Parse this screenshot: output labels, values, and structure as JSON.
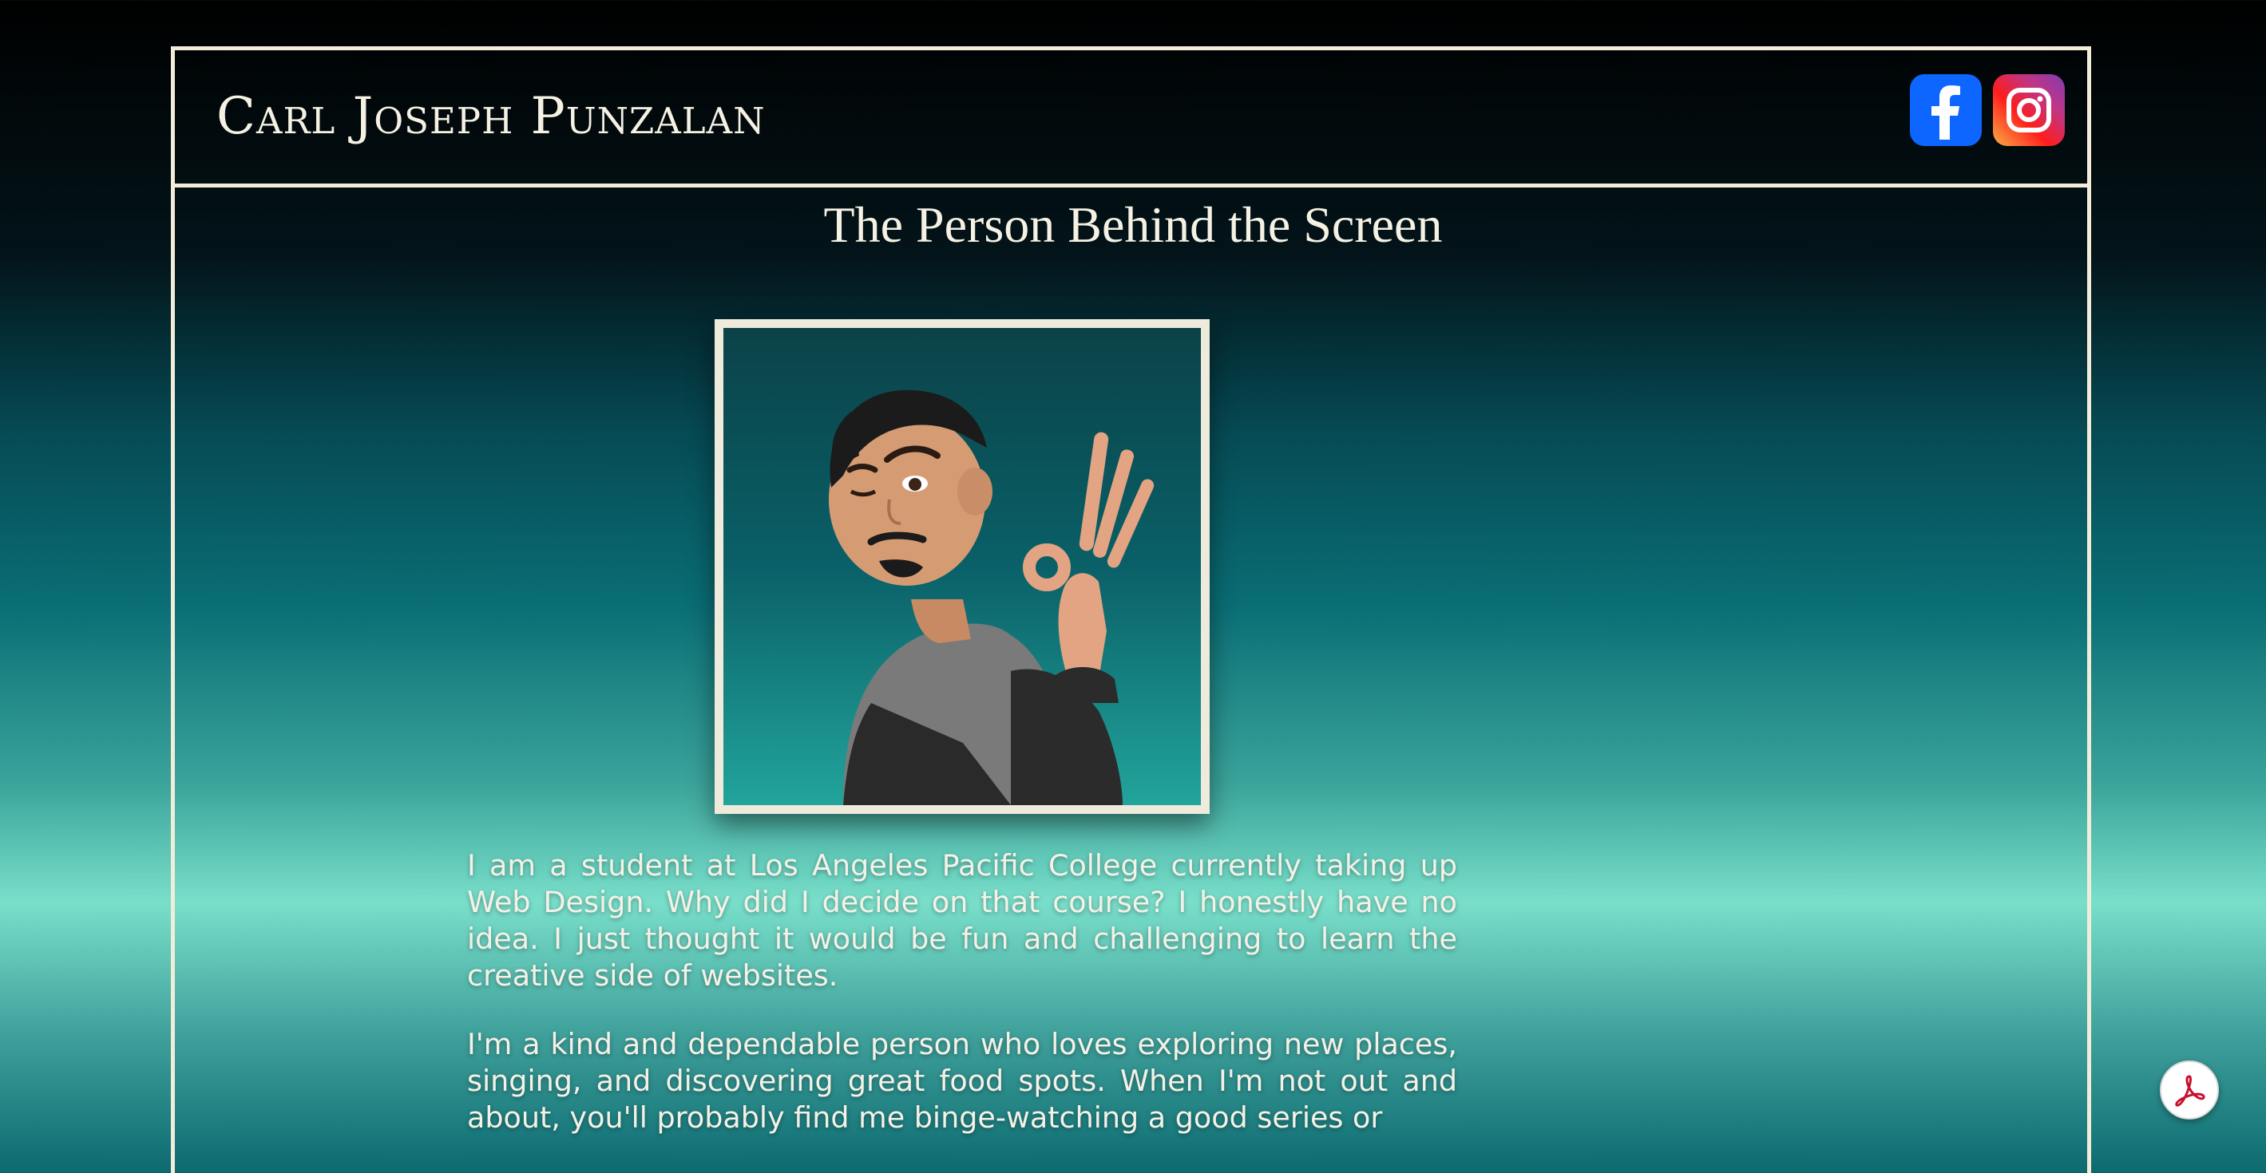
{
  "header": {
    "site_title": "Carl Joseph Punzalan",
    "social": [
      {
        "name": "facebook",
        "icon": "facebook-icon",
        "color": "#0c66ff"
      },
      {
        "name": "instagram",
        "icon": "instagram-icon"
      }
    ]
  },
  "main": {
    "heading": "The Person Behind the Screen",
    "portrait": {
      "icon": "avatar-image"
    },
    "paragraphs": [
      "I am a student at Los Angeles Pacific College currently taking up Web Design. Why did I decide on that course? I honestly have no idea. I just thought it would be fun and challenging to learn the creative side of websites.",
      "I'm a kind and dependable person who loves exploring new places, singing, and discovering great food spots. When I'm not out and about, you'll probably find me binge-watching a good series or"
    ]
  },
  "floating": {
    "pdf_icon": "pdf-icon",
    "pdf_color": "#c8102e"
  },
  "colors": {
    "frame": "#f2ecd9",
    "text": "#f5f1e3",
    "accent_teal": "#79dfca"
  }
}
